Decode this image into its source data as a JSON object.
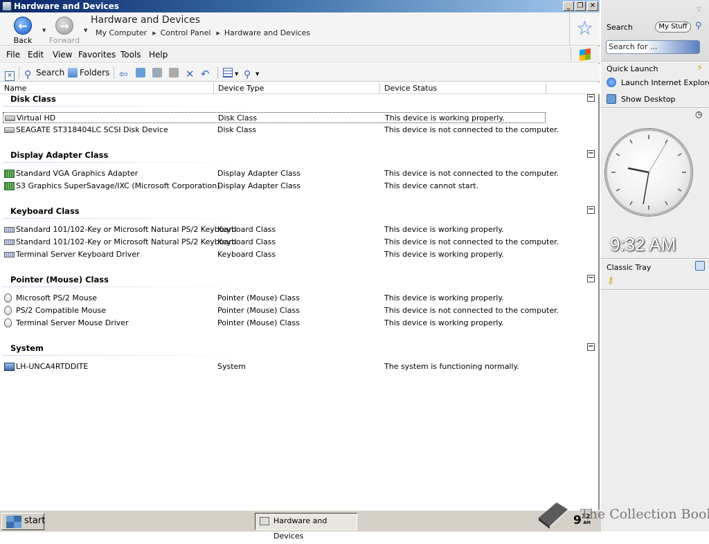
{
  "window": {
    "title": "Hardware and Devices",
    "controls": {
      "minimize": "_",
      "restore": "❐",
      "close": "✕"
    }
  },
  "address": {
    "back_label": "Back",
    "forward_label": "Forward",
    "title": "Hardware and Devices",
    "breadcrumb": [
      "My Computer",
      "Control Panel",
      "Hardware and Devices"
    ]
  },
  "menu": {
    "file": "File",
    "edit": "Edit",
    "view": "View",
    "favorites": "Favorites",
    "tools": "Tools",
    "help": "Help"
  },
  "toolbar": {
    "search": "Search",
    "folders": "Folders"
  },
  "columns": [
    "Name",
    "Device Type",
    "Device Status"
  ],
  "groups": [
    {
      "name": "Disk Class",
      "toggle": "−",
      "rows": [
        {
          "name": "Virtual HD",
          "type": "Disk Class",
          "status": "This device is working properly.",
          "icon": "disk-icon",
          "selected": true
        },
        {
          "name": "SEAGATE ST318404LC SCSI Disk Device",
          "type": "Disk Class",
          "status": "This device is not connected to the computer.",
          "icon": "disk-icon",
          "selected": false
        }
      ]
    },
    {
      "name": "Display Adapter Class",
      "toggle": "−",
      "rows": [
        {
          "name": "Standard VGA Graphics Adapter",
          "type": "Display Adapter Class",
          "status": "This device is not connected to the computer.",
          "icon": "display-adapter-icon"
        },
        {
          "name": "S3 Graphics SuperSavage/IXC (Microsoft Corporation)",
          "type": "Display Adapter Class",
          "status": "This device cannot start.",
          "icon": "display-adapter-icon"
        }
      ]
    },
    {
      "name": "Keyboard Class",
      "toggle": "−",
      "rows": [
        {
          "name": "Standard 101/102-Key or Microsoft Natural PS/2 Keyboard",
          "type": "Keyboard Class",
          "status": "This device is working properly.",
          "icon": "keyboard-icon"
        },
        {
          "name": "Standard 101/102-Key or Microsoft Natural PS/2 Keyboard",
          "type": "Keyboard Class",
          "status": "This device is not connected to the computer.",
          "icon": "keyboard-icon"
        },
        {
          "name": "Terminal Server Keyboard Driver",
          "type": "Keyboard Class",
          "status": "This device is working properly.",
          "icon": "keyboard-icon"
        }
      ]
    },
    {
      "name": "Pointer (Mouse) Class",
      "toggle": "−",
      "rows": [
        {
          "name": "Microsoft PS/2 Mouse",
          "type": "Pointer (Mouse) Class",
          "status": "This device is working properly.",
          "icon": "mouse-icon"
        },
        {
          "name": "PS/2 Compatible Mouse",
          "type": "Pointer (Mouse) Class",
          "status": "This device is not connected to the computer.",
          "icon": "mouse-icon"
        },
        {
          "name": "Terminal Server Mouse Driver",
          "type": "Pointer (Mouse) Class",
          "status": "This device is working properly.",
          "icon": "mouse-icon"
        }
      ]
    },
    {
      "name": "System",
      "toggle": "−",
      "rows": [
        {
          "name": "LH-UNCA4RTDDITE",
          "type": "System",
          "status": "The system is functioning normally.",
          "icon": "computer-icon"
        }
      ]
    }
  ],
  "sidebar": {
    "search_label": "Search",
    "my_stuff": "My Stuff",
    "search_placeholder": "Search for ...",
    "quick_launch": "Quick Launch",
    "items": [
      "Launch Internet Explorer Browser",
      "Show Desktop"
    ],
    "clock_time": "9:32 AM",
    "classic_tray": "Classic Tray"
  },
  "taskbar": {
    "start": "start",
    "task": "Hardware and Devices",
    "tray_time": "9",
    "tray_time_small": "32",
    "tray_ampm": "AM"
  },
  "watermark": "The Collection Book",
  "colors": {
    "title_start": "#0a246a",
    "title_end": "#a6caf0",
    "accent": "#3a6ea5"
  }
}
